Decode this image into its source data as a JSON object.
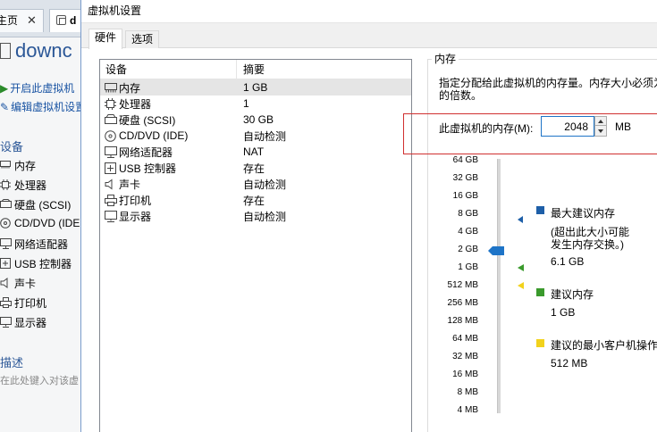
{
  "background_window": {
    "tabs": [
      {
        "label": "主页"
      },
      {
        "label": "d"
      }
    ],
    "vm_title": "downc",
    "actions": [
      {
        "label": "开启此虚拟机"
      },
      {
        "label": "编辑虚拟机设置"
      }
    ],
    "devices_heading": "设备",
    "devices": [
      {
        "label": "内存"
      },
      {
        "label": "处理器"
      },
      {
        "label": "硬盘 (SCSI)"
      },
      {
        "label": "CD/DVD (IDE"
      },
      {
        "label": "网络适配器"
      },
      {
        "label": "USB 控制器"
      },
      {
        "label": "声卡"
      },
      {
        "label": "打印机"
      },
      {
        "label": "显示器"
      }
    ],
    "description_heading": "描述",
    "description_placeholder": "在此处键入对该虚"
  },
  "dialog": {
    "title": "虚拟机设置",
    "tabs": [
      {
        "label": "硬件"
      },
      {
        "label": "选项"
      }
    ],
    "device_list": {
      "col_device": "设备",
      "col_summary": "摘要",
      "rows": [
        {
          "name": "内存",
          "summary": "1 GB",
          "icon": "memory-icon"
        },
        {
          "name": "处理器",
          "summary": "1",
          "icon": "processor-icon"
        },
        {
          "name": "硬盘 (SCSI)",
          "summary": "30 GB",
          "icon": "hard-disk-icon"
        },
        {
          "name": "CD/DVD (IDE)",
          "summary": "自动检测",
          "icon": "cd-dvd-icon"
        },
        {
          "name": "网络适配器",
          "summary": "NAT",
          "icon": "network-adapter-icon"
        },
        {
          "name": "USB 控制器",
          "summary": "存在",
          "icon": "usb-icon"
        },
        {
          "name": "声卡",
          "summary": "自动检测",
          "icon": "sound-card-icon"
        },
        {
          "name": "打印机",
          "summary": "存在",
          "icon": "printer-icon"
        },
        {
          "name": "显示器",
          "summary": "自动检测",
          "icon": "display-icon"
        }
      ]
    },
    "memory": {
      "group_title": "内存",
      "description_line1": "指定分配给此虚拟机的内存量。内存大小必须为",
      "description_line2": "的倍数。",
      "field_label": "此虚拟机的内存(M):",
      "field_value": "2048",
      "unit": "MB",
      "scale_labels": [
        "64 GB",
        "32 GB",
        "16 GB",
        "8 GB",
        "4 GB",
        "2 GB",
        "1 GB",
        "512 MB",
        "256 MB",
        "128 MB",
        "64 MB",
        "32 MB",
        "16 MB",
        "8 MB",
        "4 MB"
      ],
      "slider_selected": "2 GB",
      "legend": [
        {
          "title": "最大建议内存",
          "note_line1": "(超出此大小可能",
          "note_line2": "发生内存交换。)",
          "value": "6.1 GB",
          "color": "#1e5fa8"
        },
        {
          "title": "建议内存",
          "value": "1 GB",
          "color": "#3a9a2c"
        },
        {
          "title": "建议的最小客户机操作",
          "value": "512 MB",
          "color": "#f2d21c"
        }
      ]
    }
  }
}
